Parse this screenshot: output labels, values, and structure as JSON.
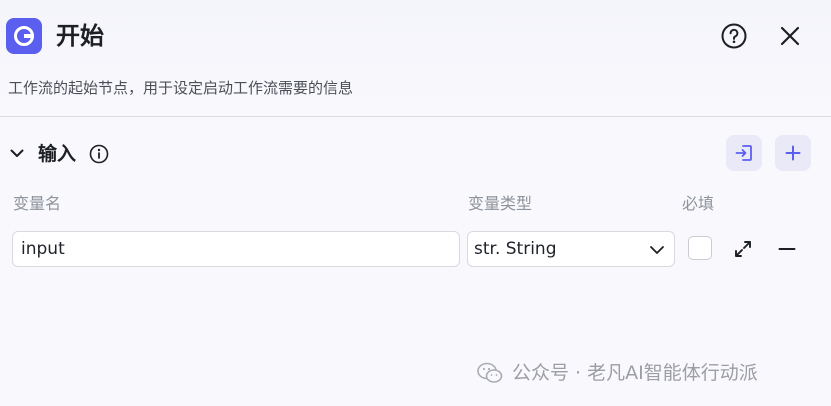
{
  "header": {
    "title": "开始",
    "description": "工作流的起始节点，用于设定启动工作流需要的信息",
    "logo_icon": "start-node-icon",
    "accent": "#5b5ff0"
  },
  "section": {
    "title": "输入",
    "columns": {
      "name": "变量名",
      "type": "变量类型",
      "required": "必填"
    }
  },
  "row": {
    "name_value": "input",
    "type_value": "str. String",
    "required": false
  },
  "watermark": {
    "text": "公众号 · 老凡AI智能体行动派"
  }
}
